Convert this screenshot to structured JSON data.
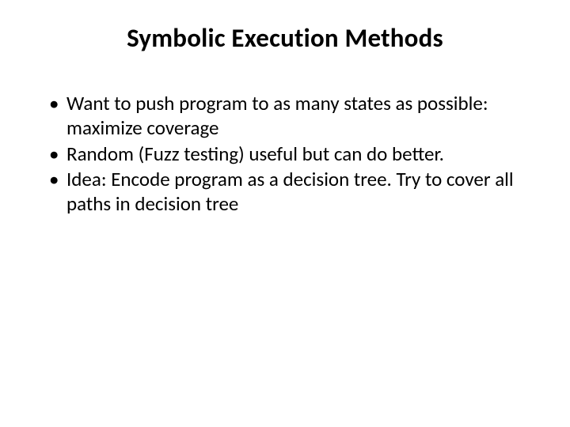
{
  "slide": {
    "title": "Symbolic Execution Methods",
    "bullets": [
      "Want to push program to as many states as possible: maximize coverage",
      "Random (Fuzz testing) useful but can do better.",
      "Idea: Encode program as a decision tree.  Try to cover all paths in decision tree"
    ]
  }
}
